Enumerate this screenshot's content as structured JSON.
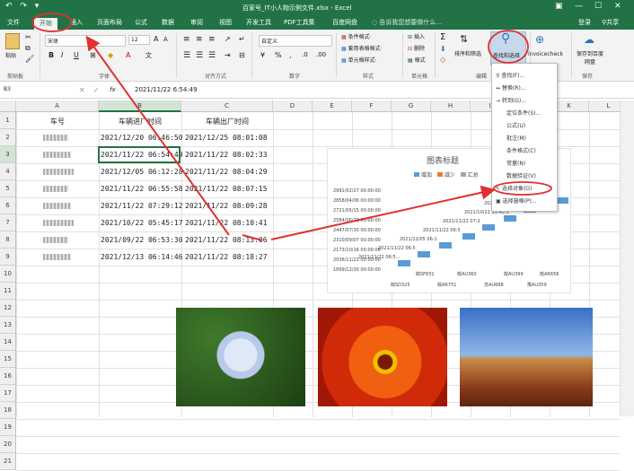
{
  "window": {
    "title": "百家号_IT小人物示例文件.xlsx - Excel",
    "qat": "↶ ↷ ▾",
    "login": "登录",
    "share": "共享"
  },
  "tabs": [
    "文件",
    "开始",
    "插入",
    "页面布局",
    "公式",
    "数据",
    "审阅",
    "视图",
    "开发工具",
    "PDF工具集",
    "百度网盘"
  ],
  "tell_me": "告诉我您想要做什么...",
  "ribbon": {
    "paste": "粘贴",
    "clipboard": "剪贴板",
    "font_name": "宋体",
    "font_size": "12",
    "font_group": "字体",
    "align_group": "对齐方式",
    "number_format": "自定义",
    "number_group": "数字",
    "cond_fmt": "条件格式·",
    "table_fmt": "套用表格格式·",
    "cell_style": "单元格样式·",
    "style_group": "样式",
    "insert": "插入",
    "delete": "删除",
    "format": "格式",
    "cells_group": "单元格",
    "sort": "排序和筛选",
    "edit_group": "编辑",
    "find": "查找和选择",
    "invoice": "invoicecheck",
    "save": "保存到百度网盘",
    "save_group": "保存"
  },
  "formula_bar": {
    "name_box": "B3",
    "fx": "fx",
    "value": "2021/11/22  6:54:49"
  },
  "columns": [
    "A",
    "B",
    "C",
    "D",
    "E",
    "F",
    "G",
    "H",
    "I",
    "J",
    "K",
    "L"
  ],
  "rows": [
    "1",
    "2",
    "3",
    "4",
    "5",
    "6",
    "7",
    "8",
    "9",
    "10",
    "11",
    "12",
    "13",
    "14",
    "15",
    "16",
    "17",
    "18",
    "19",
    "20",
    "21"
  ],
  "sheet": {
    "headers": [
      "车号",
      "车辆进厂时间",
      "车辆出厂时间"
    ],
    "data": [
      [
        "2021/12/20 06:46:50",
        "2021/12/25 08:01:08"
      ],
      [
        "2021/11/22 06:54:49",
        "2021/11/22 08:02:33"
      ],
      [
        "2021/12/05 06:12:28",
        "2021/11/22 08:04:29"
      ],
      [
        "2021/11/22 06:55:58",
        "2021/11/22 08:07:15"
      ],
      [
        "2021/11/22 07:29:12",
        "2021/11/22 08:09:28"
      ],
      [
        "2021/10/22 05:45:17",
        "2021/11/22 08:10:41"
      ],
      [
        "2021/09/22 06:53:30",
        "2021/11/22 08:13:06"
      ],
      [
        "2021/12/13 06:14:46",
        "2021/11/22 08:18:27"
      ]
    ]
  },
  "find_menu": {
    "items": [
      "查找(F)...",
      "替换(R)...",
      "转到(G)...",
      "定位条件(S)...",
      "公式(U)",
      "批注(M)",
      "条件格式(C)",
      "常量(N)",
      "数据验证(V)",
      "选择对象(O)",
      "选择窗格(P)..."
    ]
  },
  "chart": {
    "title": "图表标题",
    "legend": [
      "增加",
      "减少",
      "汇总"
    ],
    "y_ticks": [
      "2991/02/27 00:00:00",
      "2858/04/06 00:00:00",
      "2721/05/15 00:00:00",
      "2584/06/23 00:00:00",
      "2447/07/30 00:00:00",
      "2310/09/07 00:00:00",
      "2173/10/16 00:00:00",
      "2036/11/21 00:00:00",
      "1899/12/30 00:00:00"
    ],
    "bar_labels": [
      "2021/11/22 06:5...",
      "2021/11/22 06:5",
      "2021/12/05 06:1",
      "2021/11/22 06:5",
      "2021/11/22 07:2",
      "2021/10/22 05:45:1",
      "2021/12/...",
      "...14:46"
    ],
    "x_labels": [
      "皖SF831",
      "皖AU360",
      "皖AU399",
      "皖AR656",
      "皖SD325",
      "皖AR751",
      "苏AU688",
      "豫AU359"
    ]
  },
  "colors": {
    "excel_green": "#217346",
    "bar_blue": "#5b9bd5",
    "annotation_red": "#e03030"
  }
}
